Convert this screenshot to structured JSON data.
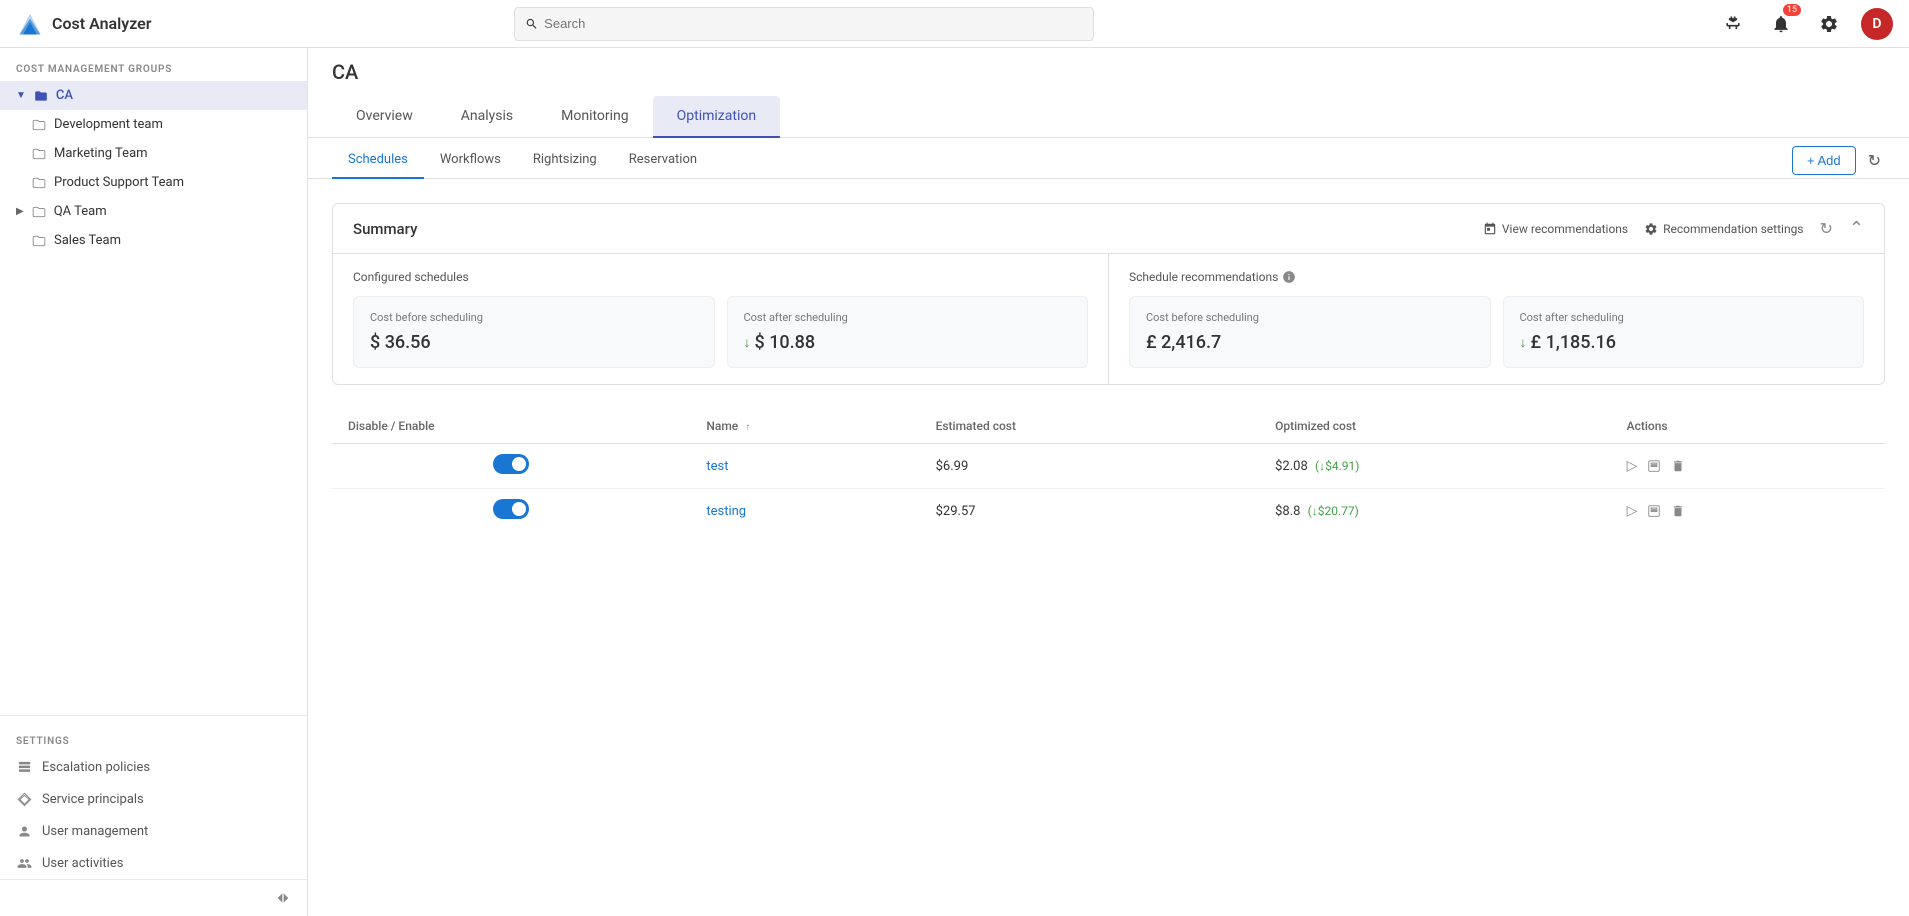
{
  "app": {
    "title": "Cost Analyzer",
    "logo_text": "Cost Analyzer"
  },
  "navbar": {
    "search_placeholder": "Search",
    "notification_count": "15",
    "user_initial": "D"
  },
  "sidebar": {
    "section_title": "COST MANAGEMENT GROUPS",
    "tree": [
      {
        "id": "ca",
        "label": "CA",
        "level": 0,
        "expanded": true,
        "active": true,
        "has_chevron": true
      },
      {
        "id": "dev",
        "label": "Development team",
        "level": 1
      },
      {
        "id": "marketing",
        "label": "Marketing Team",
        "level": 1
      },
      {
        "id": "product-support",
        "label": "Product Support Team",
        "level": 1
      },
      {
        "id": "qa",
        "label": "QA Team",
        "level": 0,
        "has_chevron": true,
        "expanded": false
      },
      {
        "id": "sales",
        "label": "Sales Team",
        "level": 1
      }
    ],
    "settings_title": "SETTINGS",
    "settings_items": [
      {
        "id": "escalation",
        "label": "Escalation policies",
        "icon": "bell"
      },
      {
        "id": "service-principals",
        "label": "Service principals",
        "icon": "diamond"
      },
      {
        "id": "user-management",
        "label": "User management",
        "icon": "user"
      },
      {
        "id": "user-activities",
        "label": "User activities",
        "icon": "user-activity"
      }
    ],
    "collapse_label": "Collapse"
  },
  "page": {
    "title": "CA",
    "main_tabs": [
      {
        "id": "overview",
        "label": "Overview",
        "active": false
      },
      {
        "id": "analysis",
        "label": "Analysis",
        "active": false
      },
      {
        "id": "monitoring",
        "label": "Monitoring",
        "active": false
      },
      {
        "id": "optimization",
        "label": "Optimization",
        "active": true
      }
    ],
    "sub_tabs": [
      {
        "id": "schedules",
        "label": "Schedules",
        "active": true
      },
      {
        "id": "workflows",
        "label": "Workflows",
        "active": false
      },
      {
        "id": "rightsizing",
        "label": "Rightsizing",
        "active": false
      },
      {
        "id": "reservation",
        "label": "Reservation",
        "active": false
      }
    ],
    "add_button_label": "+ Add"
  },
  "summary": {
    "title": "Summary",
    "view_recommendations_label": "View recommendations",
    "recommendation_settings_label": "Recommendation settings",
    "configured_schedules_title": "Configured schedules",
    "schedule_recommendations_title": "Schedule recommendations",
    "configured_cards": [
      {
        "label": "Cost before scheduling",
        "value": "$ 36.56",
        "is_down": false
      },
      {
        "label": "Cost after scheduling",
        "value": "$ 10.88",
        "is_down": true
      }
    ],
    "recommendation_cards": [
      {
        "label": "Cost before scheduling",
        "value": "£ 2,416.7",
        "is_down": false
      },
      {
        "label": "Cost after scheduling",
        "value": "£ 1,185.16",
        "is_down": true
      }
    ]
  },
  "table": {
    "columns": [
      {
        "id": "toggle",
        "label": "Disable / Enable"
      },
      {
        "id": "name",
        "label": "Name",
        "sortable": true
      },
      {
        "id": "estimated_cost",
        "label": "Estimated cost"
      },
      {
        "id": "optimized_cost",
        "label": "Optimized cost"
      },
      {
        "id": "actions",
        "label": "Actions"
      }
    ],
    "rows": [
      {
        "id": "test",
        "toggle": true,
        "name": "test",
        "estimated_cost": "$6.99",
        "optimized_cost": "$2.08",
        "savings": "(↓$4.91)"
      },
      {
        "id": "testing",
        "toggle": true,
        "name": "testing",
        "estimated_cost": "$29.57",
        "optimized_cost": "$8.8",
        "savings": "(↓$20.77)"
      }
    ]
  }
}
